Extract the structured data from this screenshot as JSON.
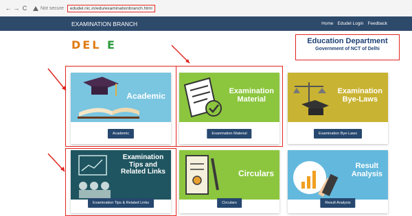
{
  "browser": {
    "back": "←",
    "forward": "→",
    "reload": "C",
    "security": "Not secure",
    "url": "edudel.nic.in/edu/examinationbranch.html"
  },
  "nav": {
    "brand": "EXAMINATION BRANCH",
    "links": [
      "Home",
      "Edudel Login",
      "Feedback"
    ]
  },
  "logo": {
    "part1": "DEL",
    "part2": "E"
  },
  "department": {
    "title": "Education Department",
    "subtitle": "Government of NCT of Delhi"
  },
  "cards": [
    {
      "title_lines": [
        "Academic"
      ],
      "button": "Academic",
      "color": "#7ac5e0"
    },
    {
      "title_lines": [
        "Examination",
        "Material"
      ],
      "button": "Examination Material",
      "color": "#8cc63f"
    },
    {
      "title_lines": [
        "Examination",
        "Bye-Laws"
      ],
      "button": "Examination Bye-Laws",
      "color": "#c9b332"
    },
    {
      "title_lines": [
        "Examination",
        "Tips and",
        "Related Links"
      ],
      "button": "Examination Tips & Related Links",
      "color": "#1f5560"
    },
    {
      "title_lines": [
        "Circulars"
      ],
      "button": "Circulars",
      "color": "#8cc63f"
    },
    {
      "title_lines": [
        "Result",
        "Analysis"
      ],
      "button": "Result Analysis",
      "color": "#63b8dd"
    }
  ],
  "colors": {
    "accent": "#2e4a6b",
    "highlight": "#e0241f"
  }
}
